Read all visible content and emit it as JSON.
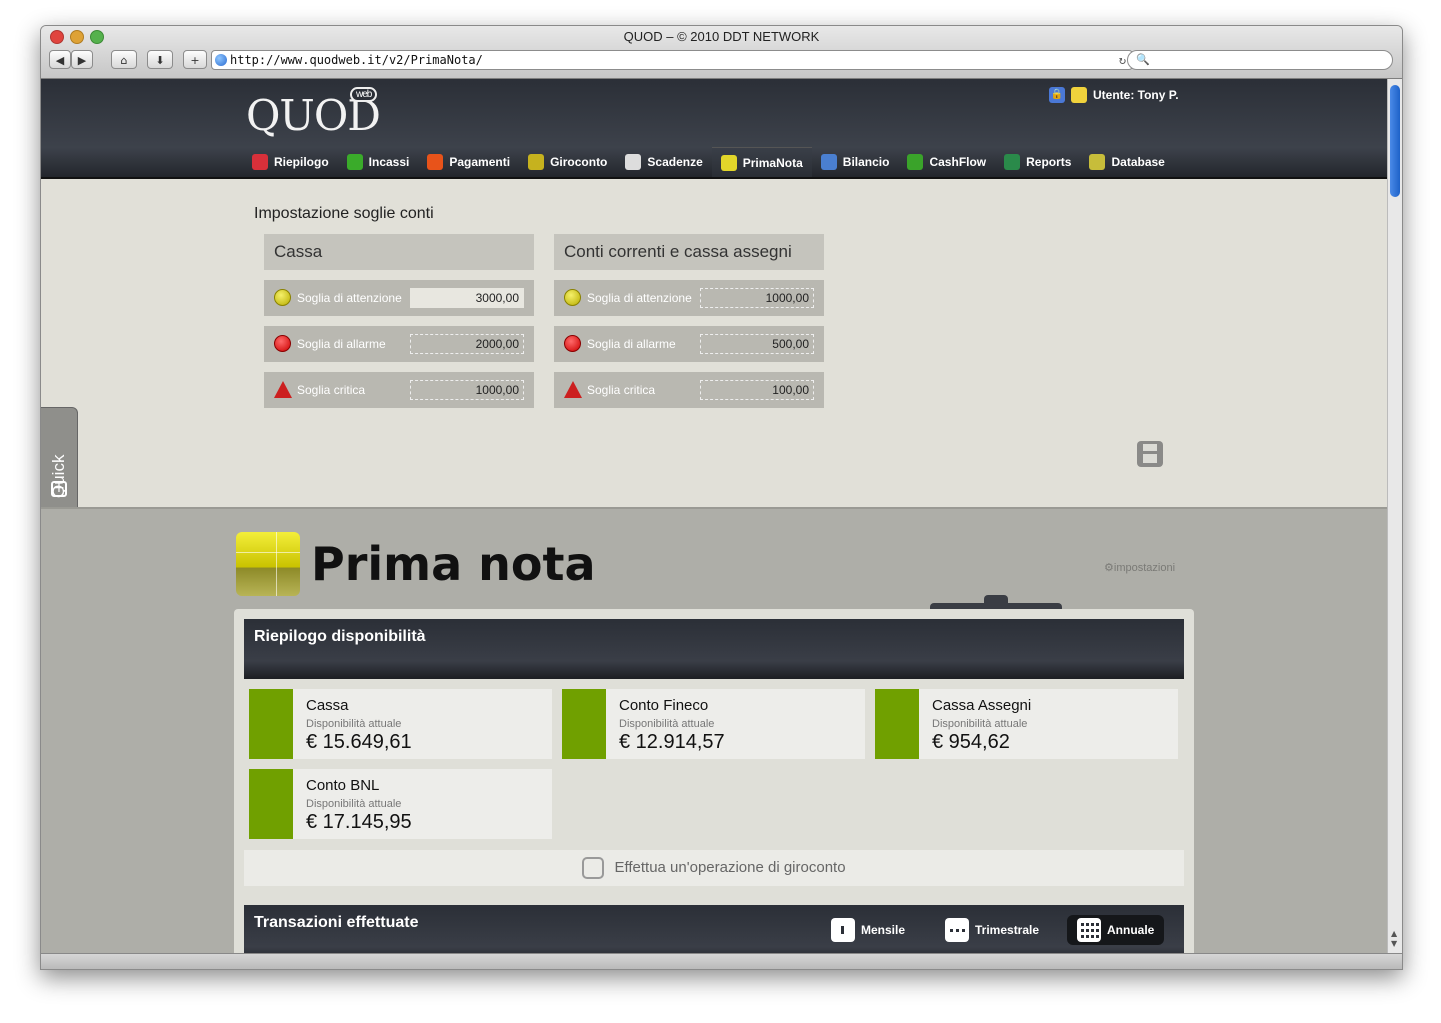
{
  "browser": {
    "title": "QUOD – © 2010 DDT NETWORK",
    "url": "http://www.quodweb.it/v2/PrimaNota/"
  },
  "header": {
    "logo": "QUOD",
    "logo_badge": "web",
    "user": "Utente: Tony P."
  },
  "nav": [
    {
      "label": "Riepilogo",
      "color": "#d8303a"
    },
    {
      "label": "Incassi",
      "color": "#3aab2a"
    },
    {
      "label": "Pagamenti",
      "color": "#e8531a"
    },
    {
      "label": "Giroconto",
      "color": "#c6b21e"
    },
    {
      "label": "Scadenze",
      "color": "#dddddd"
    },
    {
      "label": "PrimaNota",
      "color": "#e2d62a"
    },
    {
      "label": "Bilancio",
      "color": "#4a7fd0"
    },
    {
      "label": "CashFlow",
      "color": "#3aa32a"
    },
    {
      "label": "Reports",
      "color": "#2a8a4a"
    },
    {
      "label": "Database",
      "color": "#c7bd3a"
    }
  ],
  "quick": {
    "label": "Quick"
  },
  "thresholds": {
    "title": "Impostazione soglie conti",
    "columns": [
      {
        "title": "Cassa",
        "rows": [
          {
            "label": "Soglia di attenzione",
            "value": "3000,00"
          },
          {
            "label": "Soglia di allarme",
            "value": "2000,00"
          },
          {
            "label": "Soglia critica",
            "value": "1000,00"
          }
        ]
      },
      {
        "title": "Conti correnti e cassa assegni",
        "rows": [
          {
            "label": "Soglia di attenzione",
            "value": "1000,00"
          },
          {
            "label": "Soglia di allarme",
            "value": "500,00"
          },
          {
            "label": "Soglia critica",
            "value": "100,00"
          }
        ]
      }
    ]
  },
  "page": {
    "title": "Prima nota",
    "settings_link": "impostazioni"
  },
  "summary": {
    "title": "Riepilogo disponibilità",
    "accounts": [
      {
        "name": "Cassa",
        "sub": "Disponibilità attuale",
        "value": "€  15.649,61"
      },
      {
        "name": "Conto Fineco",
        "sub": "Disponibilità attuale",
        "value": "€  12.914,57"
      },
      {
        "name": "Cassa Assegni",
        "sub": "Disponibilità attuale",
        "value": "€  954,62"
      },
      {
        "name": "Conto BNL",
        "sub": "Disponibilità attuale",
        "value": "€  17.145,95"
      }
    ],
    "giroconto": "Effettua un'operazione di giroconto"
  },
  "transactions": {
    "title": "Transazioni effettuate",
    "periods": [
      "Mensile",
      "Trimestrale",
      "Annuale"
    ],
    "active_period": "Annuale"
  }
}
